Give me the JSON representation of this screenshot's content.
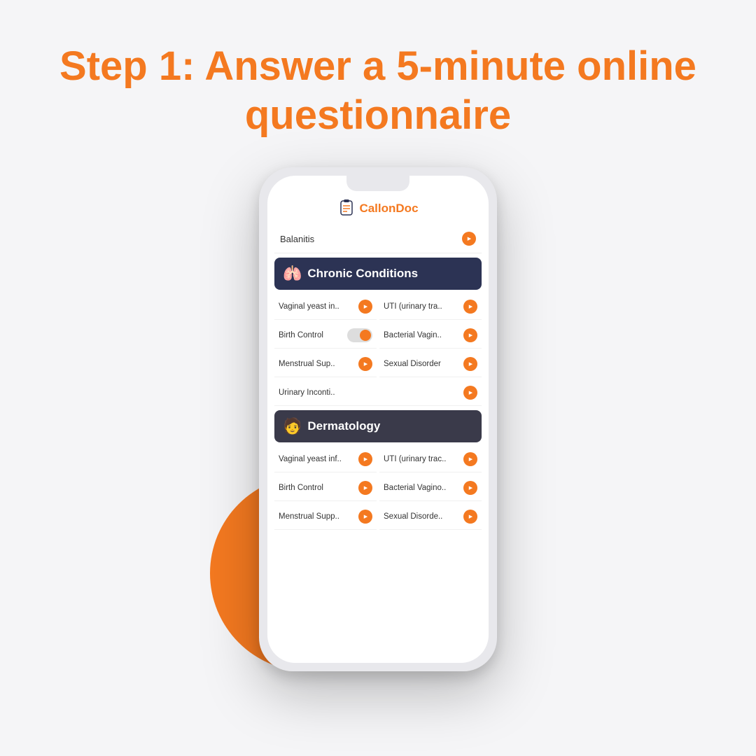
{
  "page": {
    "background": "#f5f5f7"
  },
  "header": {
    "step_label": "Step 1:",
    "title_rest": " Answer a 5-minute online questionnaire"
  },
  "logo": {
    "name_start": "Callon",
    "name_end": "Doc"
  },
  "phone": {
    "top_item": "Balanitis",
    "sections": [
      {
        "id": "chronic",
        "title": "Chronic Conditions",
        "icon": "🫁",
        "items_left": [
          "Vaginal yeast in..",
          "Birth Control",
          "Menstrual Sup..",
          "Urinary Inconti.."
        ],
        "items_right": [
          "UTI (urinary tra..",
          "Bacterial Vagin..",
          "Sexual Disorder",
          ""
        ]
      },
      {
        "id": "derm",
        "title": "Dermatology",
        "icon": "🧑",
        "items_left": [
          "Vaginal yeast inf..",
          "Birth Control",
          "Menstrual Supp.."
        ],
        "items_right": [
          "UTI (urinary trac..",
          "Bacterial Vagino..",
          "Sexual Disorde.."
        ]
      }
    ]
  }
}
